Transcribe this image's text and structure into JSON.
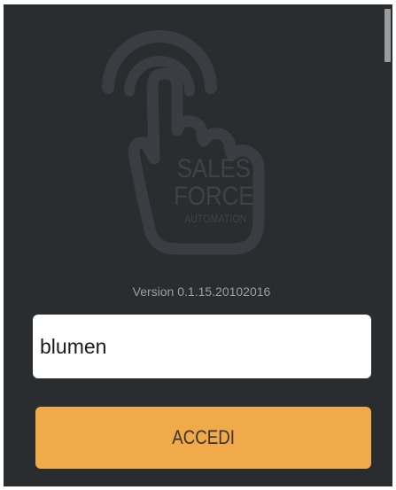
{
  "logo": {
    "icon": "touch-hand-icon",
    "line1": "SALES",
    "line2": "FORCE",
    "line3": "AUTOMATION"
  },
  "version_text": "Version 0.1.15.20102016",
  "login": {
    "username_value": "blumen",
    "submit_label": "ACCEDI"
  },
  "colors": {
    "background": "#2a2d30",
    "accent": "#f0aa4a",
    "logo": "#3f4246"
  }
}
